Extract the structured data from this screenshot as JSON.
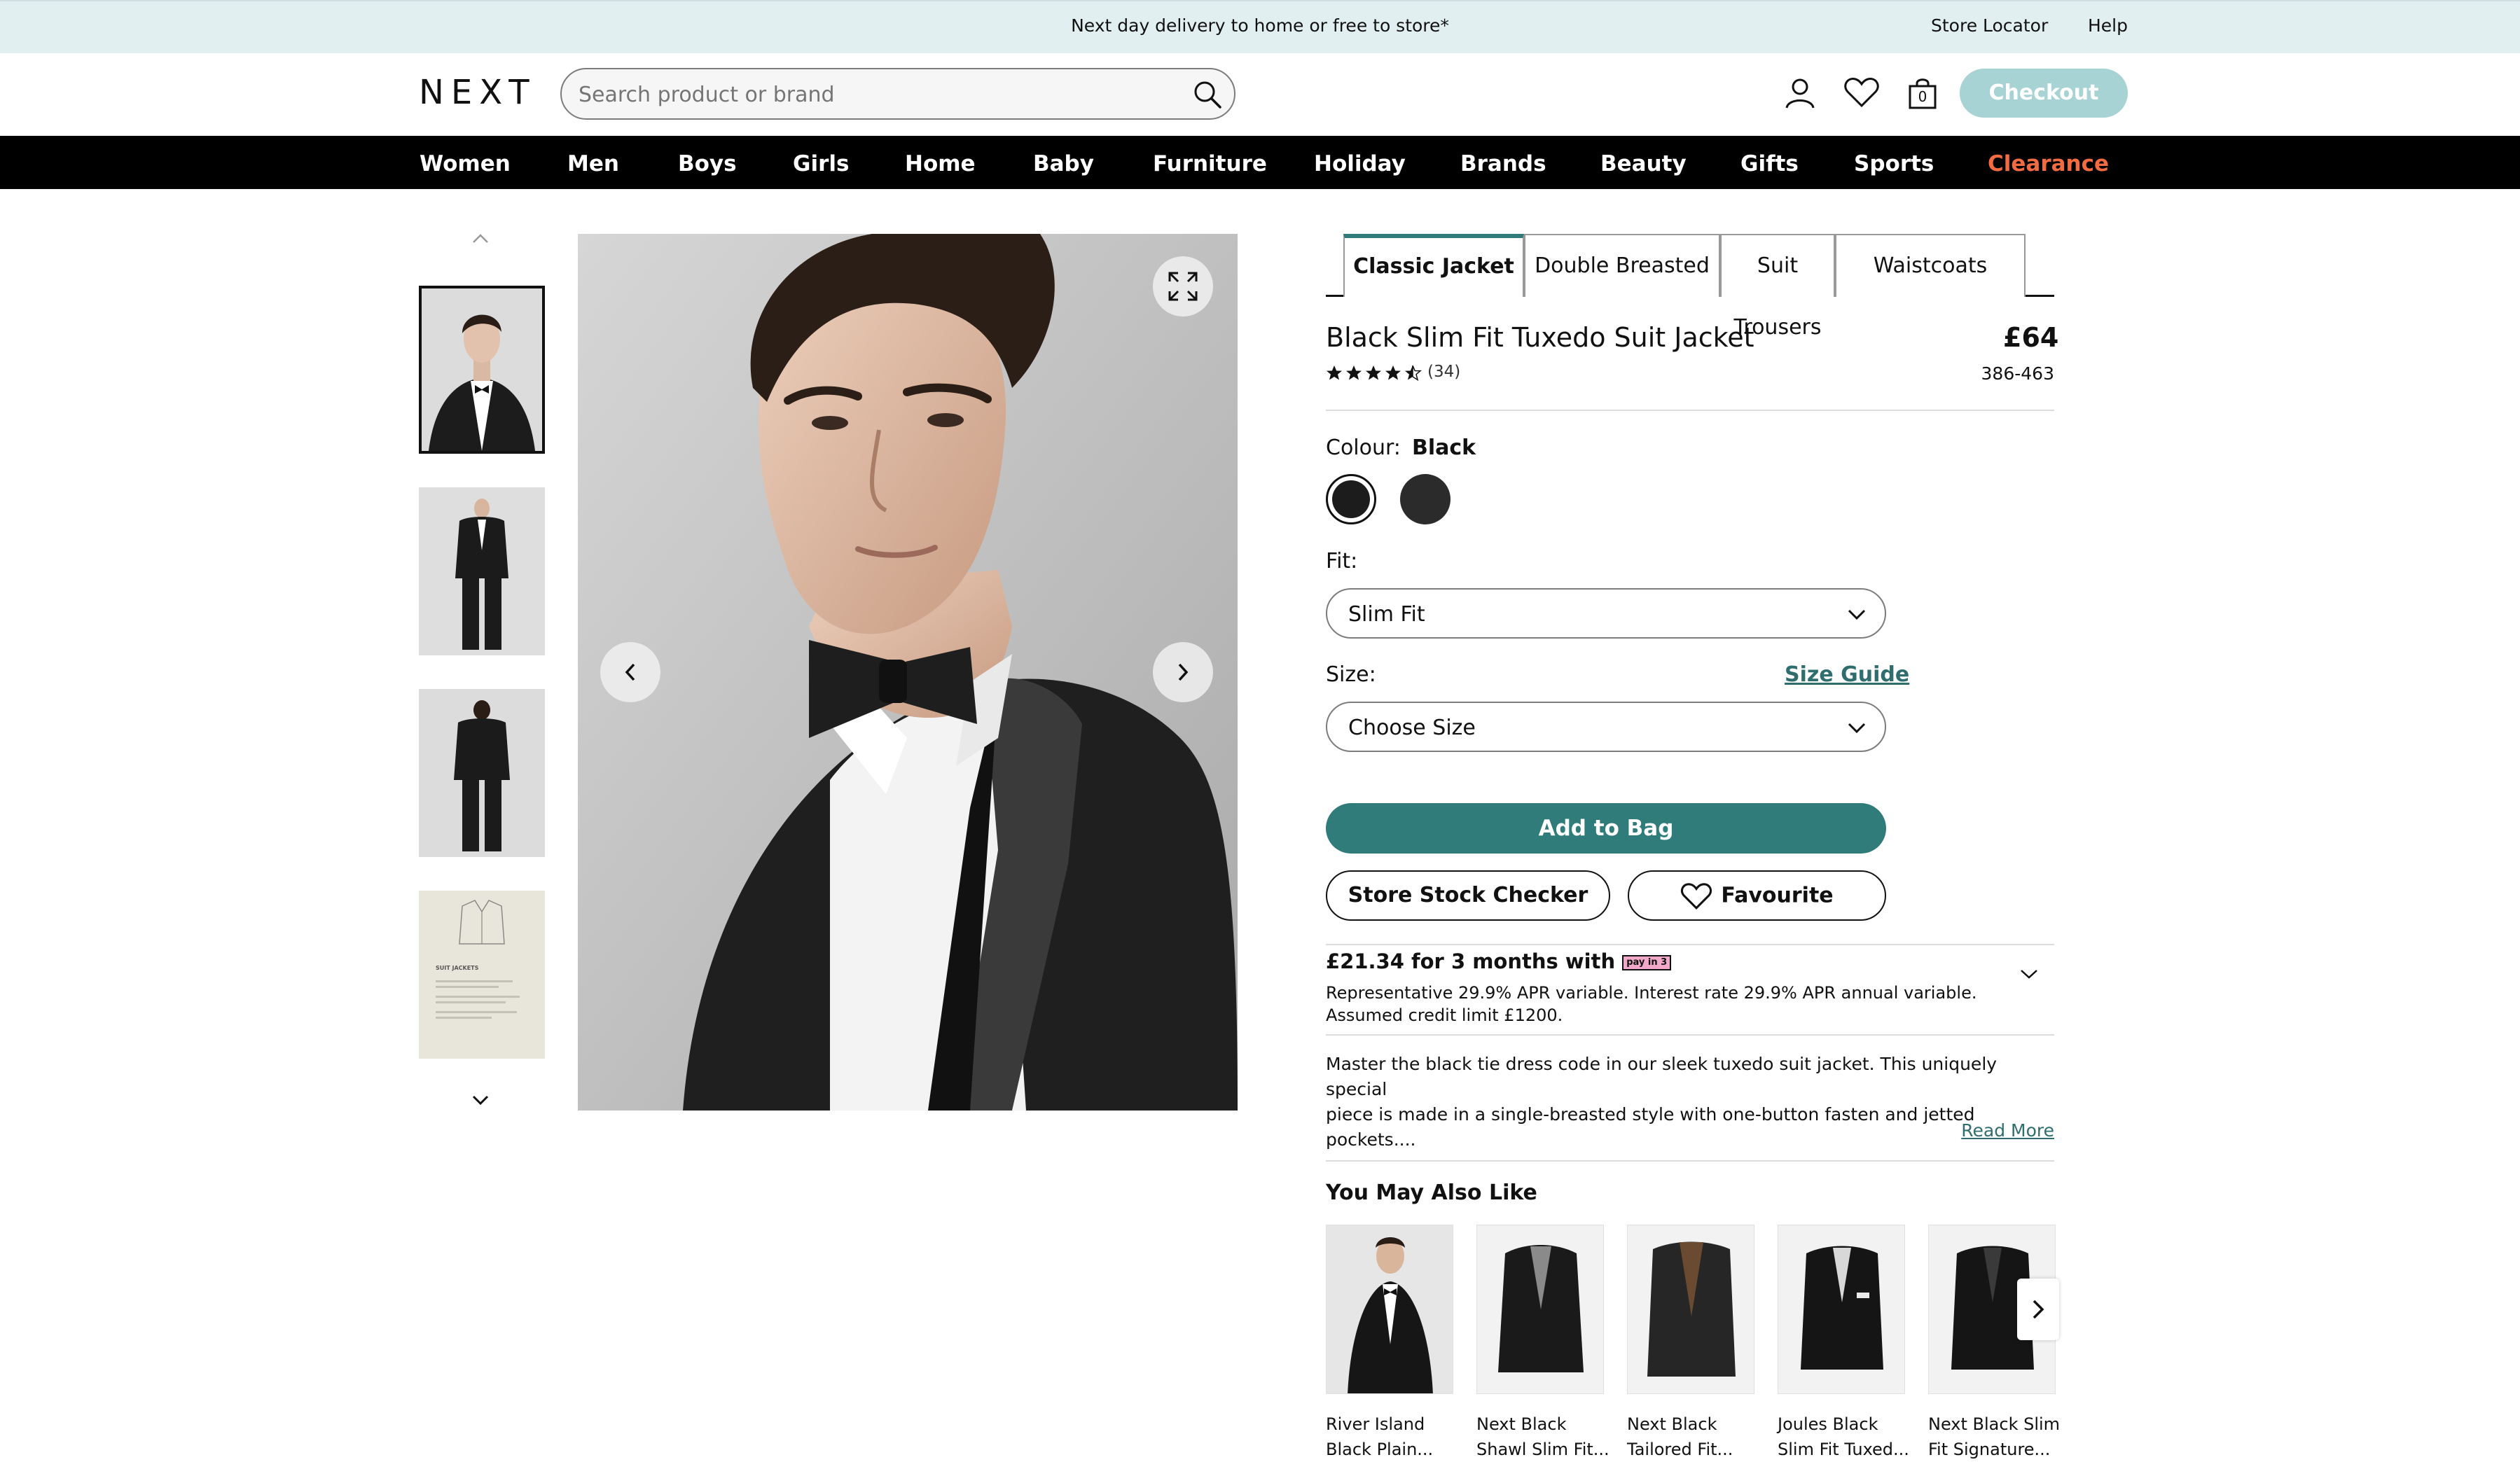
{
  "banner": {
    "message": "Next day delivery to home or free to store*",
    "store_locator": "Store Locator",
    "help": "Help"
  },
  "header": {
    "logo": "NEXT",
    "search_placeholder": "Search product or brand",
    "bag_count": "0",
    "checkout_label": "Checkout"
  },
  "nav": {
    "items": [
      "Women",
      "Men",
      "Boys",
      "Girls",
      "Home",
      "Baby",
      "Furniture",
      "Holiday",
      "Brands",
      "Beauty",
      "Gifts",
      "Sports",
      "Clearance"
    ],
    "highlight_color": "#f36b41"
  },
  "product": {
    "tabs": [
      "Classic Jacket",
      "Double Breasted",
      "Suit Trousers",
      "Waistcoats"
    ],
    "title": "Black Slim Fit Tuxedo Suit Jacket",
    "price": "£64",
    "item_code": "386-463",
    "rating": 4.5,
    "review_count": "(34)",
    "colour_label": "Colour:",
    "colour_value": "Black",
    "fit_label": "Fit:",
    "fit_value": "Slim Fit",
    "size_label": "Size:",
    "size_guide": "Size Guide",
    "size_value": "Choose Size",
    "add_to_bag": "Add to Bag",
    "store_stock": "Store Stock Checker",
    "favourite": "Favourite",
    "pay_headline": "£21.34 for 3 months with",
    "pay_badge": "pay in 3",
    "pay_detail_1": "Representative 29.9% APR variable. Interest rate 29.9% APR annual variable.",
    "pay_detail_2": "Assumed credit limit £1200.",
    "description_1": "Master the black tie dress code in our sleek tuxedo suit jacket. This uniquely special",
    "description_2": "piece is made in a single-breasted style with one-button fasten and jetted pockets....",
    "read_more": "Read More"
  },
  "thumbnail_card": {
    "heading": "SUIT JACKETS"
  },
  "recommendations": {
    "title": "You May Also Like",
    "items": [
      {
        "line1": "River Island",
        "line2": "Black Plain..."
      },
      {
        "line1": "Next Black",
        "line2": "Shawl Slim Fit..."
      },
      {
        "line1": "Next Black",
        "line2": "Tailored Fit..."
      },
      {
        "line1": "Joules Black",
        "line2": "Slim Fit Tuxed..."
      },
      {
        "line1": "Next Black Slim",
        "line2": "Fit Signature..."
      }
    ]
  },
  "colors": {
    "accent": "#307c7b",
    "banner_bg": "#e2eff0",
    "checkout_bg": "#a7d3d4"
  }
}
